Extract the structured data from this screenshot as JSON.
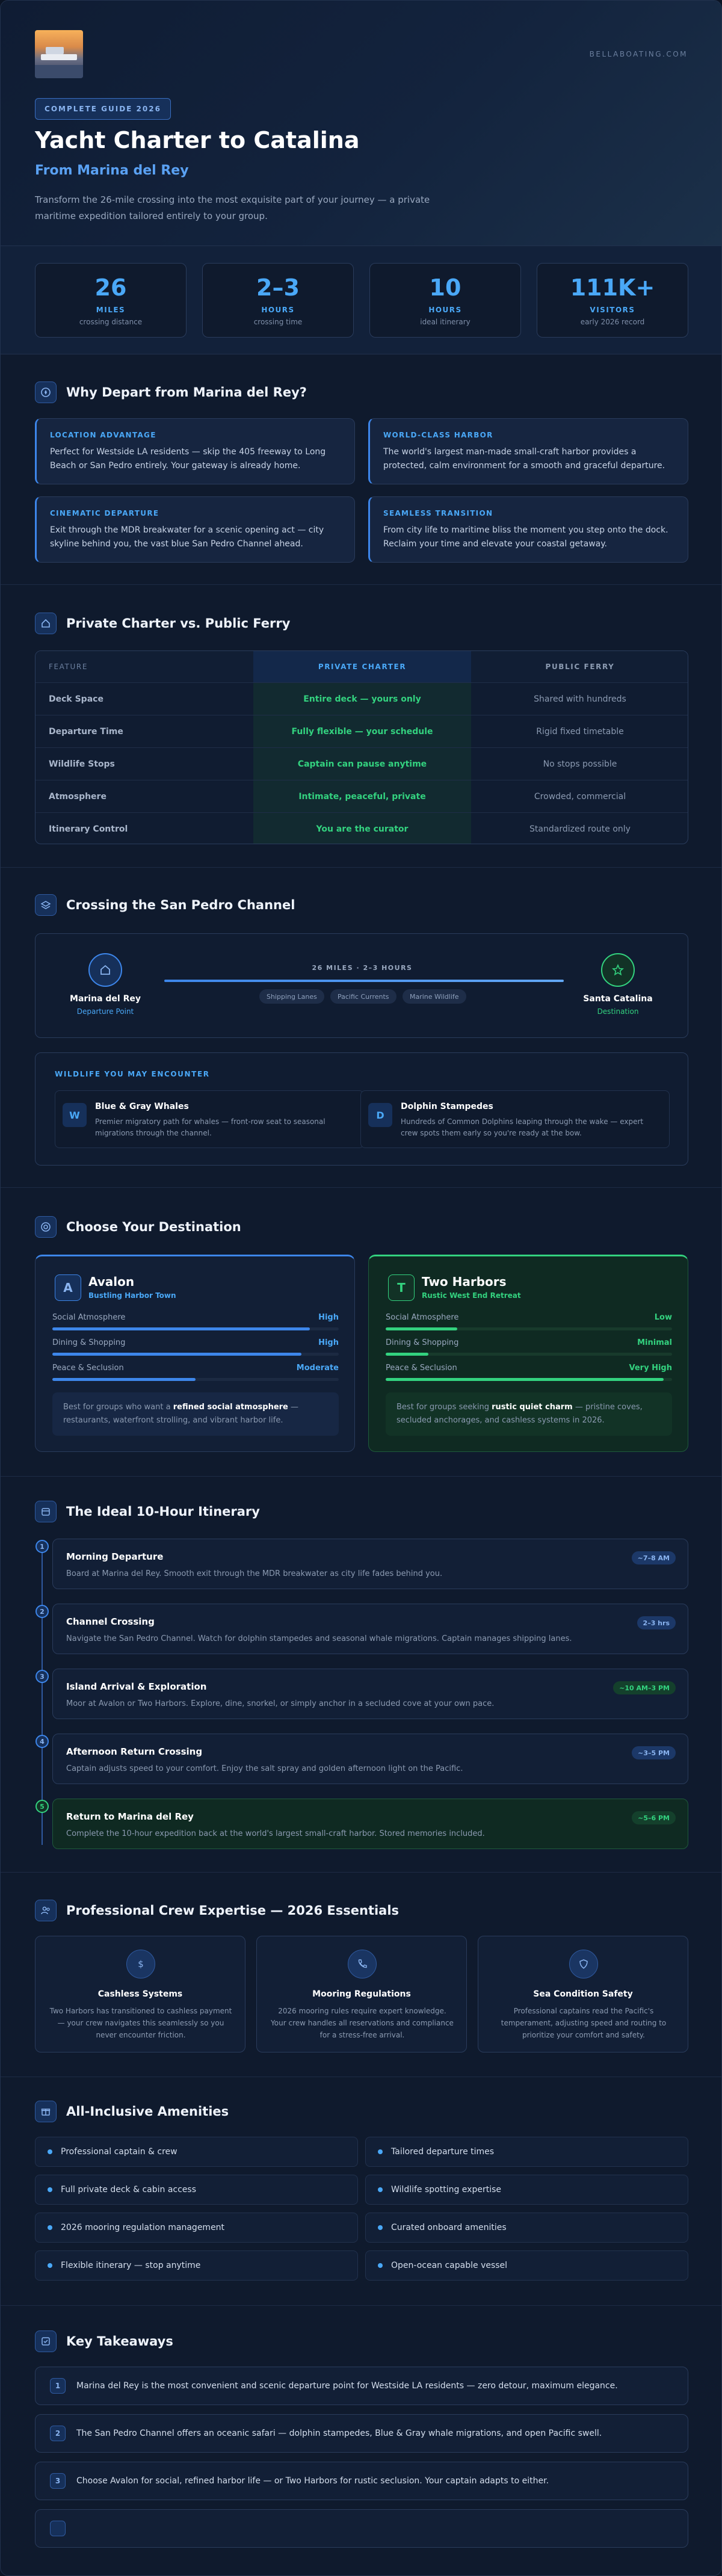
{
  "brand": "BELLABOATING.COM",
  "hero": {
    "badge": "COMPLETE GUIDE 2026",
    "title": "Yacht Charter to Catalina",
    "subtitle": "From Marina del Rey",
    "lead": "Transform the 26-mile crossing into the most exquisite part of your journey — a private maritime expedition tailored entirely to your group."
  },
  "stats": [
    {
      "value": "26",
      "unit": "MILES",
      "caption": "crossing distance"
    },
    {
      "value": "2–3",
      "unit": "HOURS",
      "caption": "crossing time"
    },
    {
      "value": "10",
      "unit": "HOURS",
      "caption": "ideal itinerary"
    },
    {
      "value": "111K+",
      "unit": "VISITORS",
      "caption": "early 2026 record"
    }
  ],
  "why": {
    "title": "Why Depart from Marina del Rey?",
    "cards": [
      {
        "kicker": "LOCATION ADVANTAGE",
        "text": "Perfect for Westside LA residents — skip the 405 freeway to Long Beach or San Pedro entirely. Your gateway is already home."
      },
      {
        "kicker": "WORLD-CLASS HARBOR",
        "text": "The world's largest man-made small-craft harbor provides a protected, calm environment for a smooth and graceful departure."
      },
      {
        "kicker": "CINEMATIC DEPARTURE",
        "text": "Exit through the MDR breakwater for a scenic opening act — city skyline behind you, the vast blue San Pedro Channel ahead."
      },
      {
        "kicker": "SEAMLESS TRANSITION",
        "text": "From city life to maritime bliss the moment you step onto the dock. Reclaim your time and elevate your coastal getaway."
      }
    ]
  },
  "compare": {
    "title": "Private Charter vs. Public Ferry",
    "headers": [
      "FEATURE",
      "PRIVATE CHARTER",
      "PUBLIC FERRY"
    ],
    "rows": [
      [
        "Deck Space",
        "Entire deck — yours only",
        "Shared with hundreds"
      ],
      [
        "Departure Time",
        "Fully flexible — your schedule",
        "Rigid fixed timetable"
      ],
      [
        "Wildlife Stops",
        "Captain can pause anytime",
        "No stops possible"
      ],
      [
        "Atmosphere",
        "Intimate, peaceful, private",
        "Crowded, commercial"
      ],
      [
        "Itinerary Control",
        "You are the curator",
        "Standardized route only"
      ]
    ]
  },
  "crossing": {
    "title": "Crossing the San Pedro Channel",
    "from": {
      "name": "Marina del Rey",
      "role": "Departure Point"
    },
    "to": {
      "name": "Santa Catalina",
      "role": "Destination"
    },
    "route_label": "26 MILES · 2–3 HOURS",
    "chips": [
      "Shipping Lanes",
      "Pacific Currents",
      "Marine Wildlife"
    ],
    "wildlife_heading": "WILDLIFE YOU MAY ENCOUNTER",
    "wildlife": [
      {
        "badge": "W",
        "name": "Blue & Gray Whales",
        "desc": "Premier migratory path for whales — front-row seat to seasonal migrations through the channel."
      },
      {
        "badge": "D",
        "name": "Dolphin Stampedes",
        "desc": "Hundreds of Common Dolphins leaping through the wake — expert crew spots them early so you're ready at the bow."
      }
    ]
  },
  "destinations": {
    "title": "Choose Your Destination",
    "avalon": {
      "badge": "A",
      "name": "Avalon",
      "tagline": "Bustling Harbor Town",
      "accent": "#3d86ea",
      "metrics": [
        {
          "label": "Social Atmosphere",
          "level": "High",
          "fill": 0.9
        },
        {
          "label": "Dining & Shopping",
          "level": "High",
          "fill": 0.87
        },
        {
          "label": "Peace & Seclusion",
          "level": "Moderate",
          "fill": 0.5
        }
      ],
      "note_pre": "Best for groups who want a ",
      "note_bold": "refined social atmosphere",
      "note_post": " — restaurants, waterfront strolling, and vibrant harbor life."
    },
    "twoharbors": {
      "badge": "T",
      "name": "Two Harbors",
      "tagline": "Rustic West End Retreat",
      "accent": "#33d27f",
      "metrics": [
        {
          "label": "Social Atmosphere",
          "level": "Low",
          "fill": 0.25
        },
        {
          "label": "Dining & Shopping",
          "level": "Minimal",
          "fill": 0.15
        },
        {
          "label": "Peace & Seclusion",
          "level": "Very High",
          "fill": 0.97
        }
      ],
      "note_pre": "Best for groups seeking ",
      "note_bold": "rustic quiet charm",
      "note_post": " — pristine coves, secluded anchorages, and cashless systems in 2026."
    }
  },
  "itinerary": {
    "title": "The Ideal 10-Hour Itinerary",
    "items": [
      {
        "n": "1",
        "title": "Morning Departure",
        "desc": "Board at Marina del Rey. Smooth exit through the MDR breakwater as city life fades behind you.",
        "time": "~7–8 AM"
      },
      {
        "n": "2",
        "title": "Channel Crossing",
        "desc": "Navigate the San Pedro Channel. Watch for dolphin stampedes and seasonal whale migrations. Captain manages shipping lanes.",
        "time": "2–3 hrs"
      },
      {
        "n": "3",
        "title": "Island Arrival & Exploration",
        "desc": "Moor at Avalon or Two Harbors. Explore, dine, snorkel, or simply anchor in a secluded cove at your own pace.",
        "time": "~10 AM–3 PM"
      },
      {
        "n": "4",
        "title": "Afternoon Return Crossing",
        "desc": "Captain adjusts speed to your comfort. Enjoy the salt spray and golden afternoon light on the Pacific.",
        "time": "~3–5 PM"
      },
      {
        "n": "5",
        "title": "Return to Marina del Rey",
        "desc": "Complete the 10-hour expedition back at the world's largest small-craft harbor. Stored memories included.",
        "time": "~5–6 PM"
      }
    ]
  },
  "crew": {
    "title": "Professional Crew Expertise — 2026 Essentials",
    "cards": [
      {
        "icon": "dollar-icon",
        "name": "Cashless Systems",
        "desc": "Two Harbors has transitioned to cashless payment — your crew navigates this seamlessly so you never encounter friction."
      },
      {
        "icon": "phone-icon",
        "name": "Mooring Regulations",
        "desc": "2026 mooring rules require expert knowledge. Your crew handles all reservations and compliance for a stress-free arrival."
      },
      {
        "icon": "shield-icon",
        "name": "Sea Condition Safety",
        "desc": "Professional captains read the Pacific's temperament, adjusting speed and routing to prioritize your comfort and safety."
      }
    ]
  },
  "amenities": {
    "title": "All-Inclusive Amenities",
    "items": [
      "Professional captain & crew",
      "Tailored departure times",
      "Full private deck & cabin access",
      "Wildlife spotting expertise",
      "2026 mooring regulation management",
      "Curated onboard amenities",
      "Flexible itinerary — stop anytime",
      "Open-ocean capable vessel"
    ]
  },
  "takeaways": {
    "title": "Key Takeaways",
    "items": [
      {
        "n": "1",
        "text": "Marina del Rey is the most convenient and scenic departure point for Westside LA residents — zero detour, maximum elegance."
      },
      {
        "n": "2",
        "text": "The San Pedro Channel offers an oceanic safari — dolphin stampedes, Blue & Gray whale migrations, and open Pacific swell."
      },
      {
        "n": "3",
        "text": "Choose Avalon for social, refined harbor life — or Two Harbors for rustic seclusion. Your captain adapts to either."
      },
      {
        "n": "",
        "text": ""
      }
    ]
  }
}
